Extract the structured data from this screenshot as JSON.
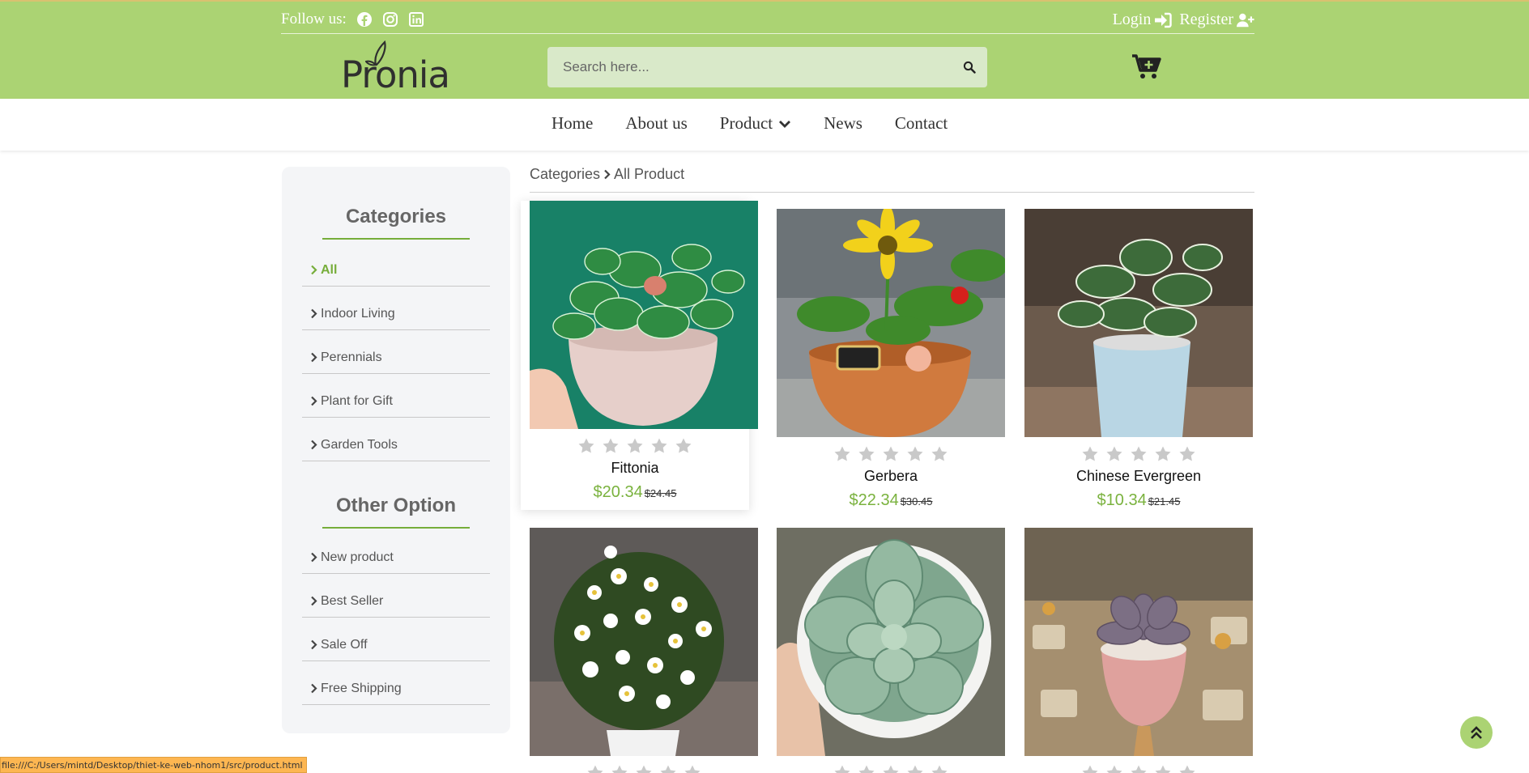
{
  "header": {
    "follow_label": "Follow us:",
    "social_icons": [
      "facebook-icon",
      "instagram-icon",
      "linkedin-icon"
    ],
    "login_label": "Login",
    "register_label": "Register",
    "brand": "Pronia",
    "search_placeholder": "Search here...",
    "band_color": "#abd373"
  },
  "nav": {
    "items": [
      {
        "label": "Home"
      },
      {
        "label": "About us"
      },
      {
        "label": "Product",
        "has_dropdown": true
      },
      {
        "label": "News"
      },
      {
        "label": "Contact"
      }
    ]
  },
  "sidebar": {
    "categories_title": "Categories",
    "categories": [
      {
        "label": "All",
        "active": true
      },
      {
        "label": "Indoor Living"
      },
      {
        "label": "Perennials"
      },
      {
        "label": "Plant for Gift"
      },
      {
        "label": "Garden Tools"
      }
    ],
    "other_title": "Other Option",
    "other": [
      {
        "label": "New product"
      },
      {
        "label": "Best Seller"
      },
      {
        "label": "Sale Off"
      },
      {
        "label": "Free Shipping"
      }
    ]
  },
  "breadcrumb": {
    "root": "Categories",
    "current": "All Product"
  },
  "products": [
    {
      "name": "Fittonia",
      "price": "$20.34",
      "old_price": "$24.45",
      "rating": 0
    },
    {
      "name": "Gerbera",
      "price": "$22.34",
      "old_price": "$30.45",
      "rating": 0
    },
    {
      "name": "Chinese Evergreen",
      "price": "$10.34",
      "old_price": "$21.45",
      "rating": 0
    },
    {
      "name": "",
      "price": "",
      "old_price": "",
      "rating": 0
    },
    {
      "name": "",
      "price": "",
      "old_price": "",
      "rating": 0
    },
    {
      "name": "",
      "price": "",
      "old_price": "",
      "rating": 0
    }
  ],
  "status_url": "file:///C:/Users/mintd/Desktop/thiet-ke-web-nhom1/src/product.html",
  "colors": {
    "accent": "#76ad3a",
    "price": "#7ab23e"
  }
}
